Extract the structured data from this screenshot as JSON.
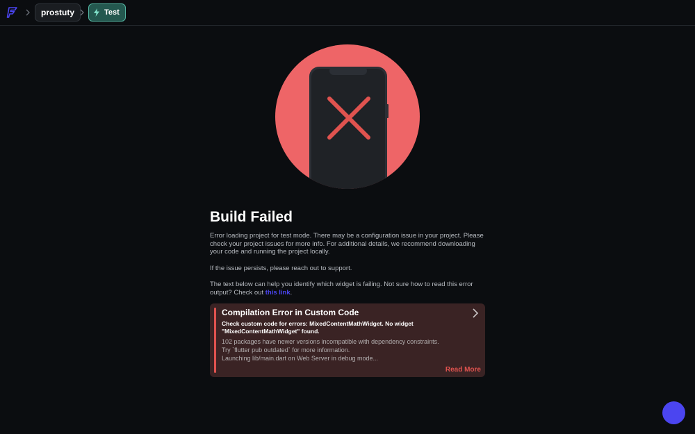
{
  "breadcrumb": {
    "project": "prostuty",
    "mode": "Test"
  },
  "icons": {
    "logo": "flutterflow-logo-icon",
    "separator": "chevron-right-icon",
    "mode": "lightning-icon",
    "illustration": "phone-error-x-icon",
    "expand": "chevron-right-icon"
  },
  "main": {
    "title": "Build Failed",
    "para1": "Error loading project for test mode. There may be a configuration issue in your project. Please check your project issues for more info. For additional details, we recommend downloading your code and running the project locally.",
    "para2": "If the issue persists, please reach out to support.",
    "para3_prefix": "The text below can help you identify which widget is failing. Not sure how to read this error output? Check out ",
    "para3_link": "this link",
    "para3_suffix": "."
  },
  "error": {
    "title": "Compilation Error in Custom Code",
    "subtitle": "Check custom code for errors: MixedContentMathWidget. No widget \"MixedContentMathWidget\" found.",
    "log": [
      "102 packages have newer versions incompatible with dependency constraints.",
      "Try `flutter pub outdated` for more information.",
      "Launching lib/main.dart on Web Server in debug mode..."
    ],
    "read_more": "Read More"
  },
  "colors": {
    "accent": "#4b45f0",
    "error": "#e0534f",
    "test_badge": "#24584f",
    "illustration_circle": "#ee6567"
  }
}
